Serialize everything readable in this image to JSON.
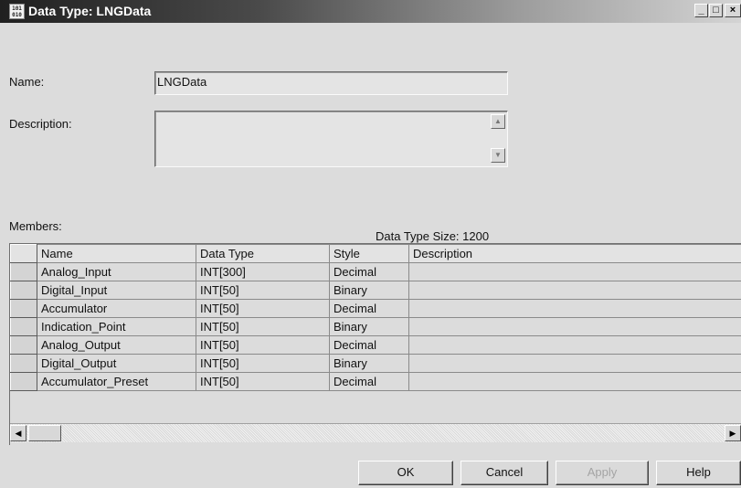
{
  "window": {
    "icon_text": "101 010",
    "title": "Data Type: LNGData",
    "minimize_label": "_",
    "maximize_label": "□",
    "close_label": "×"
  },
  "form": {
    "name_label": "Name:",
    "name_value": "LNGData",
    "description_label": "Description:",
    "description_value": "",
    "members_label": "Members:",
    "size_label": "Data Type Size: 1200"
  },
  "table": {
    "headers": [
      "Name",
      "Data Type",
      "Style",
      "Description"
    ],
    "rows": [
      {
        "name": "Analog_Input",
        "data_type": "INT[300]",
        "style": "Decimal",
        "description": ""
      },
      {
        "name": "Digital_Input",
        "data_type": "INT[50]",
        "style": "Binary",
        "description": ""
      },
      {
        "name": "Accumulator",
        "data_type": "INT[50]",
        "style": "Decimal",
        "description": ""
      },
      {
        "name": "Indication_Point",
        "data_type": "INT[50]",
        "style": "Binary",
        "description": ""
      },
      {
        "name": "Analog_Output",
        "data_type": "INT[50]",
        "style": "Decimal",
        "description": ""
      },
      {
        "name": "Digital_Output",
        "data_type": "INT[50]",
        "style": "Binary",
        "description": ""
      },
      {
        "name": "Accumulator_Preset",
        "data_type": "INT[50]",
        "style": "Decimal",
        "description": ""
      }
    ]
  },
  "buttons": {
    "ok": "OK",
    "cancel": "Cancel",
    "apply": "Apply",
    "help": "Help"
  }
}
